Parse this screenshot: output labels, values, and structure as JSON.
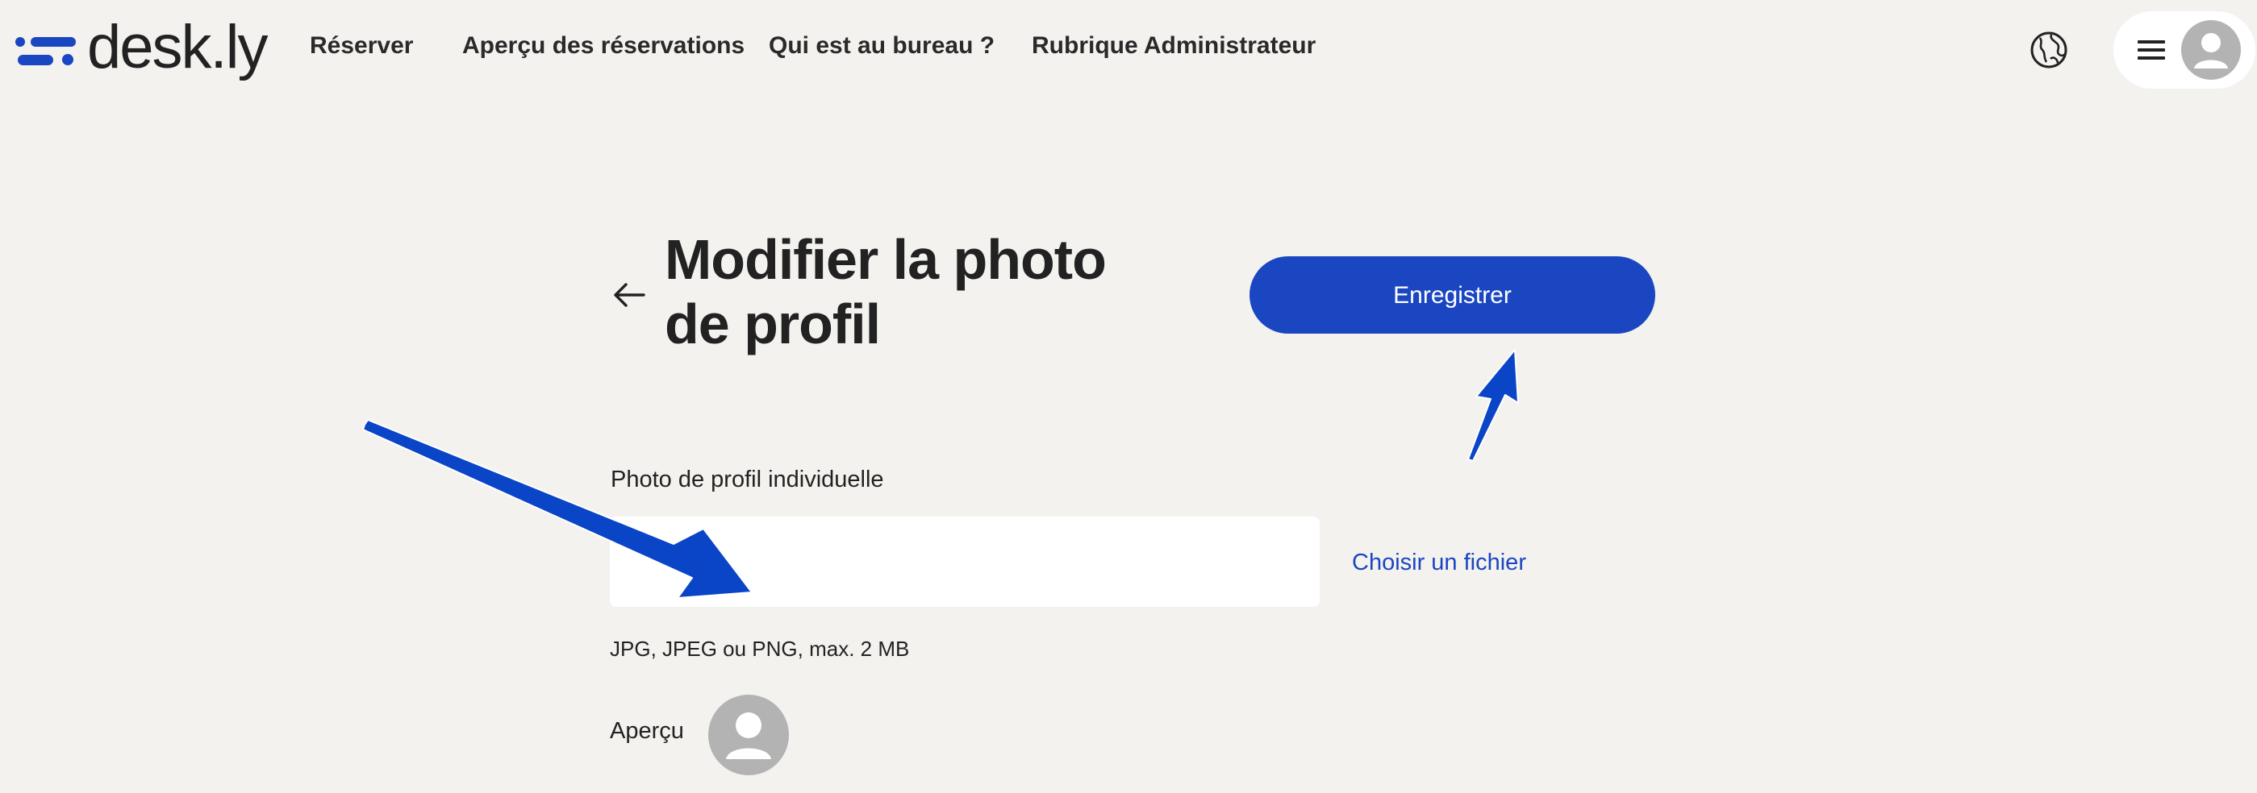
{
  "app": {
    "logo_text": "desk.ly",
    "brand_color": "#1b46c2"
  },
  "nav": {
    "items": [
      {
        "label": "Réserver"
      },
      {
        "label": "Aperçu des réservations"
      },
      {
        "label": "Qui est au bureau ?"
      },
      {
        "label": "Rubrique Administrateur"
      }
    ]
  },
  "header_icons": {
    "language": "globe-icon",
    "menu": "hamburger-menu-icon",
    "avatar": "user-avatar-icon"
  },
  "page": {
    "title": "Modifier la photo de profil",
    "back_icon": "arrow-left-icon",
    "save_label": "Enregistrer"
  },
  "upload": {
    "label": "Photo de profil individuelle",
    "value": "",
    "choose_label": "Choisir un fichier",
    "hint": "JPG, JPEG ou PNG, max. 2 MB"
  },
  "preview": {
    "label": "Aperçu",
    "avatar_icon": "default-avatar-icon"
  },
  "annotations": {
    "arrow_color": "#0a45c8"
  }
}
